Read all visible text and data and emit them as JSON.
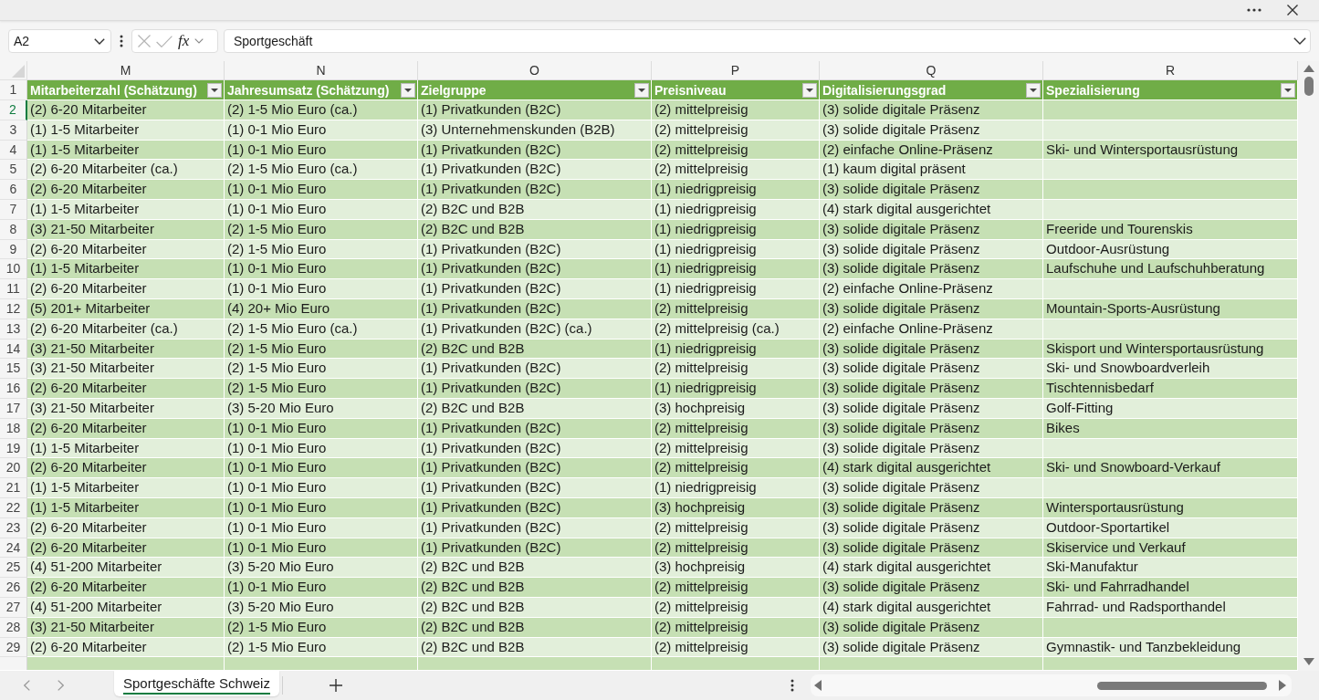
{
  "formula_bar": {
    "name_box": "A2",
    "function_button": "fx",
    "formula": "Sportgeschäft"
  },
  "sheet": {
    "columns": [
      {
        "letter": "M",
        "heading": "Mitarbeiterzahl (Schätzung)"
      },
      {
        "letter": "N",
        "heading": "Jahresumsatz (Schätzung)"
      },
      {
        "letter": "O",
        "heading": "Zielgruppe"
      },
      {
        "letter": "P",
        "heading": "Preisniveau"
      },
      {
        "letter": "Q",
        "heading": "Digitalisierungsgrad"
      },
      {
        "letter": "R",
        "heading": "Spezialisierung"
      }
    ],
    "header_row_number": "1",
    "rows": [
      {
        "number": "2",
        "selected": true,
        "cells": [
          "(2) 6-20 Mitarbeiter",
          "(2) 1-5 Mio Euro (ca.)",
          "(1) Privatkunden (B2C)",
          "(2) mittelpreisig",
          "(3) solide digitale Präsenz"
        ]
      },
      {
        "number": "3",
        "selected": false,
        "cells": [
          "(1) 1-5 Mitarbeiter",
          "(1) 0-1 Mio Euro",
          "(3) Unternehmenskunden (B2B)",
          "(2) mittelpreisig",
          "(3) solide digitale Präsenz"
        ]
      },
      {
        "number": "4",
        "selected": false,
        "cells": [
          "(1) 1-5 Mitarbeiter",
          "(1) 0-1 Mio Euro",
          "(1) Privatkunden (B2C)",
          "(2) mittelpreisig",
          "(2) einfache Online-Präsenz",
          "Ski- und Wintersportausrüstung"
        ]
      },
      {
        "number": "5",
        "selected": false,
        "cells": [
          "(2) 6-20 Mitarbeiter (ca.)",
          "(2) 1-5 Mio Euro (ca.)",
          "(1) Privatkunden (B2C)",
          "(2) mittelpreisig",
          "(1) kaum digital präsent"
        ]
      },
      {
        "number": "6",
        "selected": false,
        "cells": [
          "(2) 6-20 Mitarbeiter",
          "(1) 0-1 Mio Euro",
          "(1) Privatkunden (B2C)",
          "(1) niedrigpreisig",
          "(3) solide digitale Präsenz"
        ]
      },
      {
        "number": "7",
        "selected": false,
        "cells": [
          "(1) 1-5 Mitarbeiter",
          "(1) 0-1 Mio Euro",
          "(2) B2C und B2B",
          "(1) niedrigpreisig",
          "(4) stark digital ausgerichtet"
        ]
      },
      {
        "number": "8",
        "selected": false,
        "cells": [
          "(3) 21-50 Mitarbeiter",
          "(2) 1-5 Mio Euro",
          "(2) B2C und B2B",
          "(1) niedrigpreisig",
          "(3) solide digitale Präsenz",
          "Freeride und Tourenskis"
        ]
      },
      {
        "number": "9",
        "selected": false,
        "cells": [
          "(2) 6-20 Mitarbeiter",
          "(2) 1-5 Mio Euro",
          "(1) Privatkunden (B2C)",
          "(1) niedrigpreisig",
          "(3) solide digitale Präsenz",
          "Outdoor-Ausrüstung"
        ]
      },
      {
        "number": "10",
        "selected": false,
        "cells": [
          "(1) 1-5 Mitarbeiter",
          "(1) 0-1 Mio Euro",
          "(1) Privatkunden (B2C)",
          "(1) niedrigpreisig",
          "(3) solide digitale Präsenz",
          "Laufschuhe und Laufschuhberatung"
        ]
      },
      {
        "number": "11",
        "selected": false,
        "cells": [
          "(2) 6-20 Mitarbeiter",
          "(1) 0-1 Mio Euro",
          "(1) Privatkunden (B2C)",
          "(1) niedrigpreisig",
          "(2) einfache Online-Präsenz"
        ]
      },
      {
        "number": "12",
        "selected": false,
        "cells": [
          "(5) 201+ Mitarbeiter",
          "(4) 20+ Mio Euro",
          "(1) Privatkunden (B2C)",
          "(2) mittelpreisig",
          "(3) solide digitale Präsenz",
          "Mountain-Sports-Ausrüstung"
        ]
      },
      {
        "number": "13",
        "selected": false,
        "cells": [
          "(2) 6-20 Mitarbeiter (ca.)",
          "(2) 1-5 Mio Euro (ca.)",
          "(1) Privatkunden (B2C) (ca.)",
          "(2) mittelpreisig (ca.)",
          "(2) einfache Online-Präsenz"
        ]
      },
      {
        "number": "14",
        "selected": false,
        "cells": [
          "(3) 21-50 Mitarbeiter",
          "(2) 1-5 Mio Euro",
          "(2) B2C und B2B",
          "(1) niedrigpreisig",
          "(3) solide digitale Präsenz",
          "Skisport und Wintersportausrüstung"
        ]
      },
      {
        "number": "15",
        "selected": false,
        "cells": [
          "(3) 21-50 Mitarbeiter",
          "(2) 1-5 Mio Euro",
          "(1) Privatkunden (B2C)",
          "(2) mittelpreisig",
          "(3) solide digitale Präsenz",
          "Ski- und Snowboardverleih"
        ]
      },
      {
        "number": "16",
        "selected": false,
        "cells": [
          "(2) 6-20 Mitarbeiter",
          "(2) 1-5 Mio Euro",
          "(1) Privatkunden (B2C)",
          "(1) niedrigpreisig",
          "(3) solide digitale Präsenz",
          "Tischtennisbedarf"
        ]
      },
      {
        "number": "17",
        "selected": false,
        "cells": [
          "(3) 21-50 Mitarbeiter",
          "(3) 5-20 Mio Euro",
          "(2) B2C und B2B",
          "(3) hochpreisig",
          "(3) solide digitale Präsenz",
          "Golf-Fitting"
        ]
      },
      {
        "number": "18",
        "selected": false,
        "cells": [
          "(2) 6-20 Mitarbeiter",
          "(1) 0-1 Mio Euro",
          "(1) Privatkunden (B2C)",
          "(2) mittelpreisig",
          "(3) solide digitale Präsenz",
          "Bikes"
        ]
      },
      {
        "number": "19",
        "selected": false,
        "cells": [
          "(1) 1-5 Mitarbeiter",
          "(1) 0-1 Mio Euro",
          "(1) Privatkunden (B2C)",
          "(2) mittelpreisig",
          "(3) solide digitale Präsenz"
        ]
      },
      {
        "number": "20",
        "selected": false,
        "cells": [
          "(2) 6-20 Mitarbeiter",
          "(1) 0-1 Mio Euro",
          "(1) Privatkunden (B2C)",
          "(2) mittelpreisig",
          "(4) stark digital ausgerichtet",
          "Ski- und Snowboard-Verkauf"
        ]
      },
      {
        "number": "21",
        "selected": false,
        "cells": [
          "(1) 1-5 Mitarbeiter",
          "(1) 0-1 Mio Euro",
          "(1) Privatkunden (B2C)",
          "(1) niedrigpreisig",
          "(3) solide digitale Präsenz"
        ]
      },
      {
        "number": "22",
        "selected": false,
        "cells": [
          "(1) 1-5 Mitarbeiter",
          "(1) 0-1 Mio Euro",
          "(1) Privatkunden (B2C)",
          "(3) hochpreisig",
          "(3) solide digitale Präsenz",
          "Wintersportausrüstung"
        ]
      },
      {
        "number": "23",
        "selected": false,
        "cells": [
          "(2) 6-20 Mitarbeiter",
          "(1) 0-1 Mio Euro",
          "(1) Privatkunden (B2C)",
          "(2) mittelpreisig",
          "(3) solide digitale Präsenz",
          "Outdoor-Sportartikel"
        ]
      },
      {
        "number": "24",
        "selected": false,
        "cells": [
          "(2) 6-20 Mitarbeiter",
          "(1) 0-1 Mio Euro",
          "(1) Privatkunden (B2C)",
          "(2) mittelpreisig",
          "(3) solide digitale Präsenz",
          "Skiservice und Verkauf"
        ]
      },
      {
        "number": "25",
        "selected": false,
        "cells": [
          "(4) 51-200 Mitarbeiter",
          "(3) 5-20 Mio Euro",
          "(2) B2C und B2B",
          "(3) hochpreisig",
          "(4) stark digital ausgerichtet",
          "Ski-Manufaktur"
        ]
      },
      {
        "number": "26",
        "selected": false,
        "cells": [
          "(2) 6-20 Mitarbeiter",
          "(1) 0-1 Mio Euro",
          "(2) B2C und B2B",
          "(2) mittelpreisig",
          "(3) solide digitale Präsenz",
          "Ski- und Fahrradhandel"
        ]
      },
      {
        "number": "27",
        "selected": false,
        "cells": [
          "(4) 51-200 Mitarbeiter",
          "(3) 5-20 Mio Euro",
          "(2) B2C und B2B",
          "(2) mittelpreisig",
          "(4) stark digital ausgerichtet",
          "Fahrrad- und Radsporthandel"
        ]
      },
      {
        "number": "28",
        "selected": false,
        "cells": [
          "(3) 21-50 Mitarbeiter",
          "(2) 1-5 Mio Euro",
          "(2) B2C und B2B",
          "(2) mittelpreisig",
          "(3) solide digitale Präsenz"
        ]
      },
      {
        "number": "29",
        "selected": false,
        "cells": [
          "(2) 6-20 Mitarbeiter",
          "(2) 1-5 Mio Euro",
          "(2) B2C und B2B",
          "(2) mittelpreisig",
          "(3) solide digitale Präsenz",
          "Gymnastik- und Tanzbekleidung"
        ]
      }
    ]
  },
  "sheet_tabs": [
    {
      "label": "Sportgeschäfte Schweiz",
      "selected": true
    }
  ]
}
